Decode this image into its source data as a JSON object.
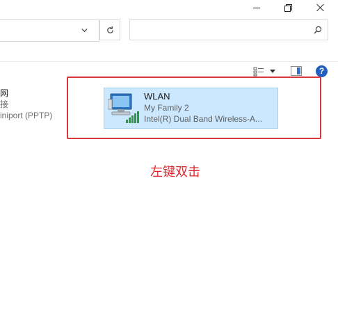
{
  "left_connection": {
    "name": "网",
    "status": "接",
    "device": "iniport (PPTP)"
  },
  "wlan": {
    "title": "WLAN",
    "network": "My Family 2",
    "adapter": "Intel(R) Dual Band Wireless-A..."
  },
  "annotation": {
    "label": "左键双击",
    "color": "#e0262d"
  },
  "toolbar": {
    "help_label": "?"
  },
  "icons": [
    "minimize-icon",
    "restore-icon",
    "close-icon",
    "chevron-down-icon",
    "refresh-icon",
    "search-icon",
    "view-options-icon",
    "preview-pane-icon",
    "help-icon",
    "wlan-adapter-icon"
  ],
  "colors": {
    "selection_bg": "#cce8ff",
    "selection_border": "#99d1ff",
    "help_blue": "#1f5fbf"
  }
}
